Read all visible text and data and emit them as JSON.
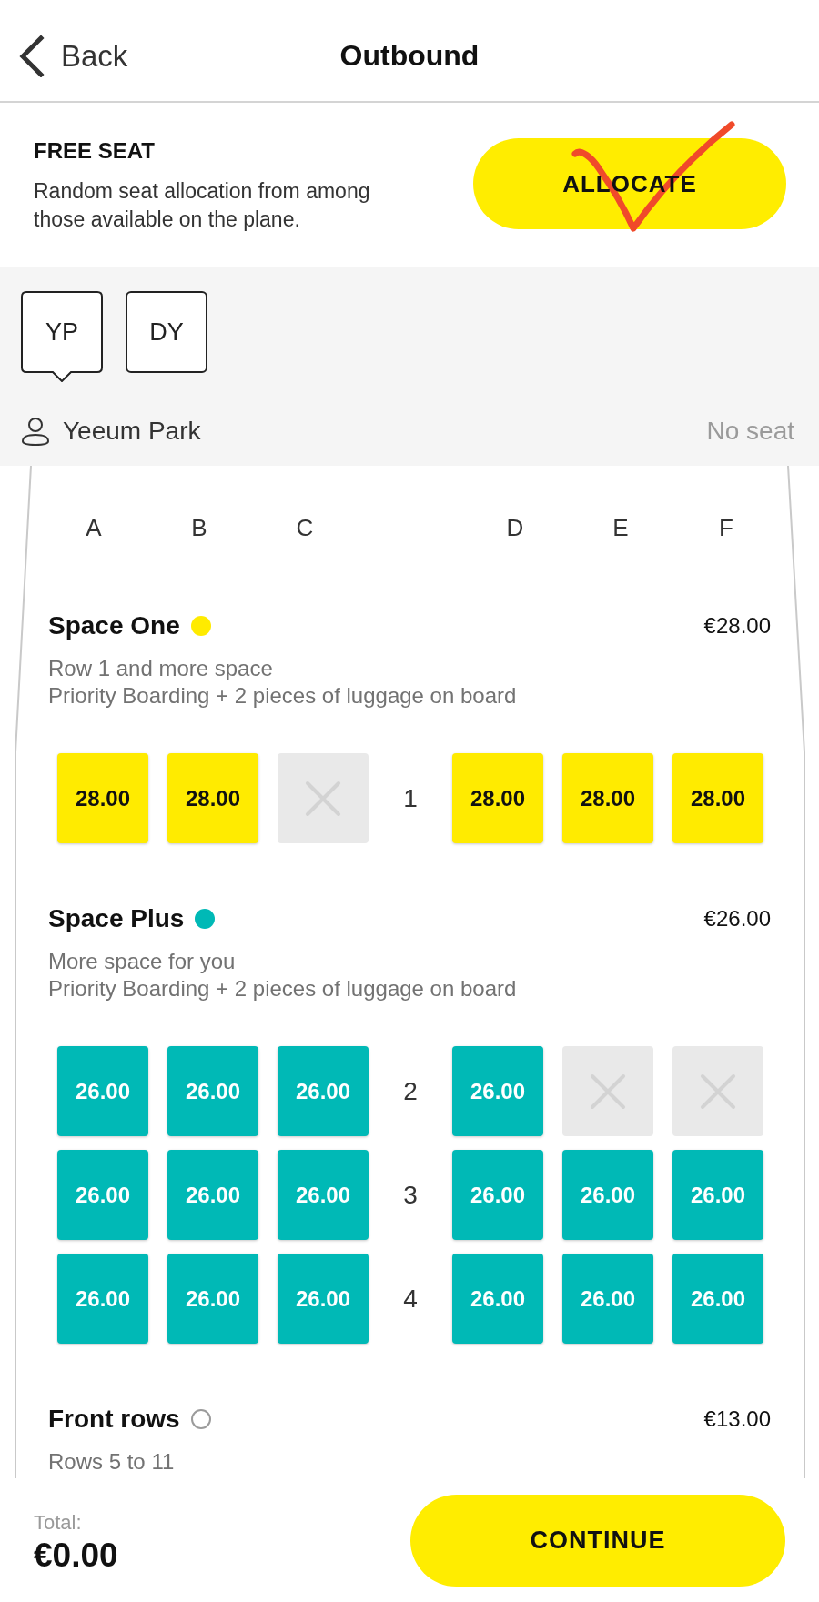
{
  "header": {
    "back_label": "Back",
    "title": "Outbound"
  },
  "free_seat": {
    "title": "FREE SEAT",
    "description": "Random seat allocation from among those available on the plane.",
    "button": "ALLOCATE"
  },
  "passengers": {
    "tabs": [
      {
        "initials": "YP",
        "selected": true
      },
      {
        "initials": "DY",
        "selected": false
      }
    ],
    "current": {
      "name": "Yeeum Park",
      "seat": "No seat"
    }
  },
  "seat_map": {
    "columns": [
      "A",
      "B",
      "C",
      "D",
      "E",
      "F"
    ],
    "zones": [
      {
        "name": "Space One",
        "kind": "filled",
        "color": "#ffeb00",
        "price": "€28.00",
        "description": [
          "Row 1 and more space",
          "Priority Boarding + 2 pieces of luggage on board"
        ],
        "rows": [
          {
            "number": "1",
            "seats": [
              {
                "kind": "available",
                "price": "28.00"
              },
              {
                "kind": "available",
                "price": "28.00"
              },
              {
                "kind": "taken"
              },
              {
                "kind": "available",
                "price": "28.00"
              },
              {
                "kind": "available",
                "price": "28.00"
              },
              {
                "kind": "available",
                "price": "28.00"
              }
            ]
          }
        ]
      },
      {
        "name": "Space Plus",
        "kind": "filled",
        "color": "#00b9b6",
        "price": "€26.00",
        "description": [
          "More space for you",
          "Priority Boarding + 2 pieces of luggage on board"
        ],
        "rows": [
          {
            "number": "2",
            "seats": [
              {
                "kind": "available",
                "price": "26.00"
              },
              {
                "kind": "available",
                "price": "26.00"
              },
              {
                "kind": "available",
                "price": "26.00"
              },
              {
                "kind": "available",
                "price": "26.00"
              },
              {
                "kind": "taken"
              },
              {
                "kind": "taken"
              }
            ]
          },
          {
            "number": "3",
            "seats": [
              {
                "kind": "available",
                "price": "26.00"
              },
              {
                "kind": "available",
                "price": "26.00"
              },
              {
                "kind": "available",
                "price": "26.00"
              },
              {
                "kind": "available",
                "price": "26.00"
              },
              {
                "kind": "available",
                "price": "26.00"
              },
              {
                "kind": "available",
                "price": "26.00"
              }
            ]
          },
          {
            "number": "4",
            "seats": [
              {
                "kind": "available",
                "price": "26.00"
              },
              {
                "kind": "available",
                "price": "26.00"
              },
              {
                "kind": "available",
                "price": "26.00"
              },
              {
                "kind": "available",
                "price": "26.00"
              },
              {
                "kind": "available",
                "price": "26.00"
              },
              {
                "kind": "available",
                "price": "26.00"
              }
            ]
          }
        ]
      },
      {
        "name": "Front rows",
        "kind": "ring",
        "color": "#9b9b9b",
        "price": "€13.00",
        "description": [
          "Rows 5 to 11"
        ]
      }
    ]
  },
  "footer": {
    "total_label": "Total:",
    "total": "€0.00",
    "button": "CONTINUE"
  }
}
